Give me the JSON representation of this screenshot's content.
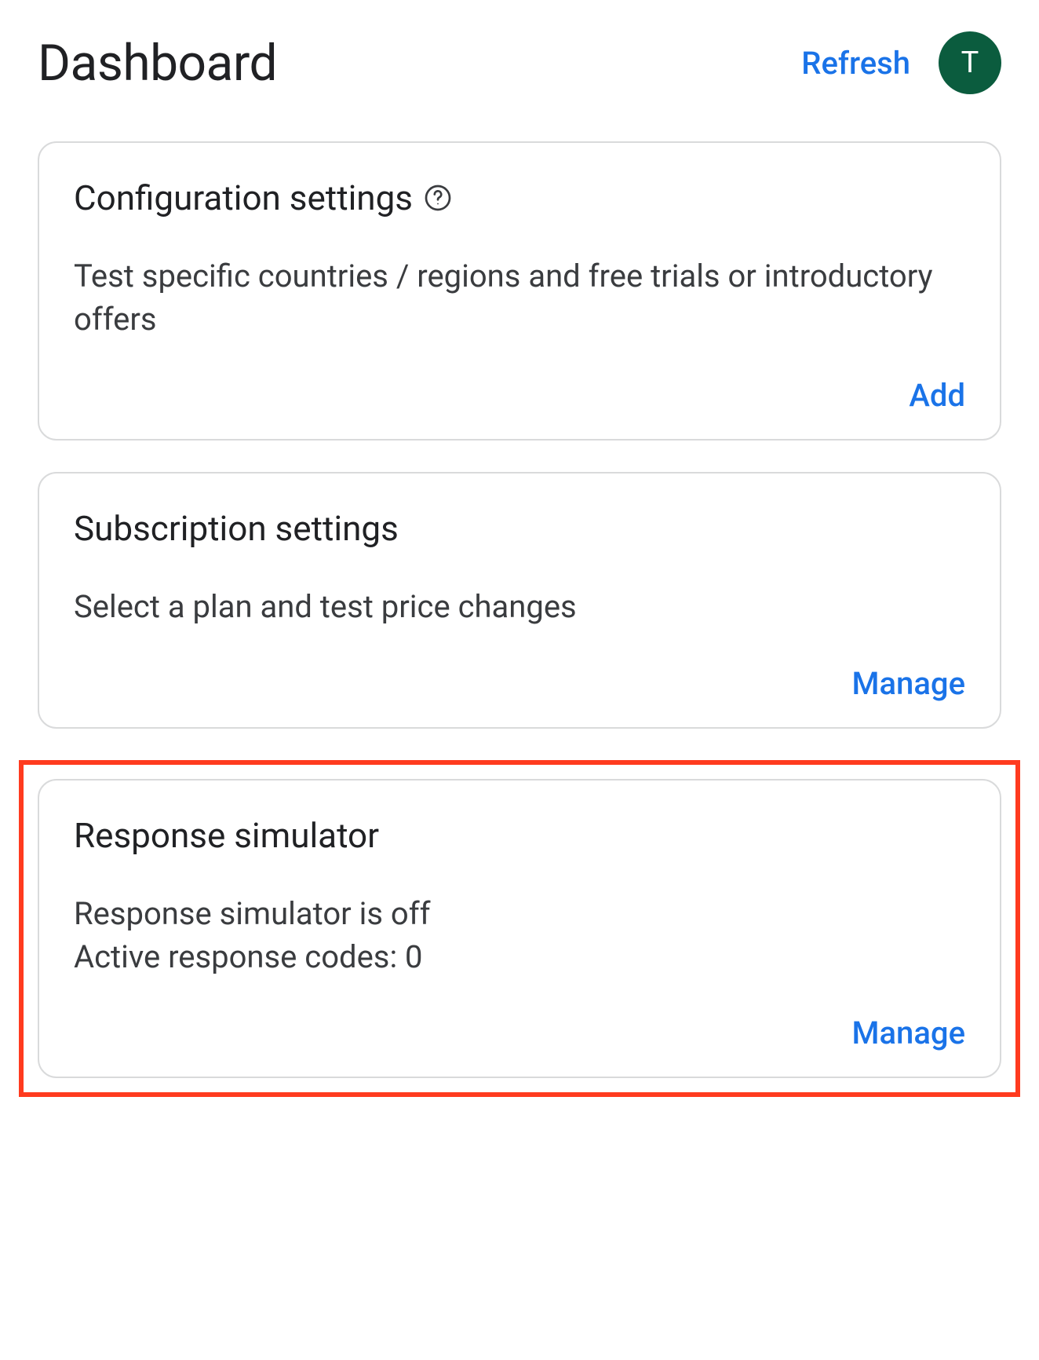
{
  "header": {
    "title": "Dashboard",
    "refresh_label": "Refresh",
    "avatar_initial": "T"
  },
  "cards": {
    "config": {
      "title": "Configuration settings",
      "description": "Test specific countries / regions and free trials or introductory offers",
      "action": "Add"
    },
    "subscription": {
      "title": "Subscription settings",
      "description": "Select a plan and test price changes",
      "action": "Manage"
    },
    "response": {
      "title": "Response simulator",
      "status_line": "Response simulator is off",
      "codes_line": "Active response codes: 0",
      "action": "Manage"
    }
  }
}
